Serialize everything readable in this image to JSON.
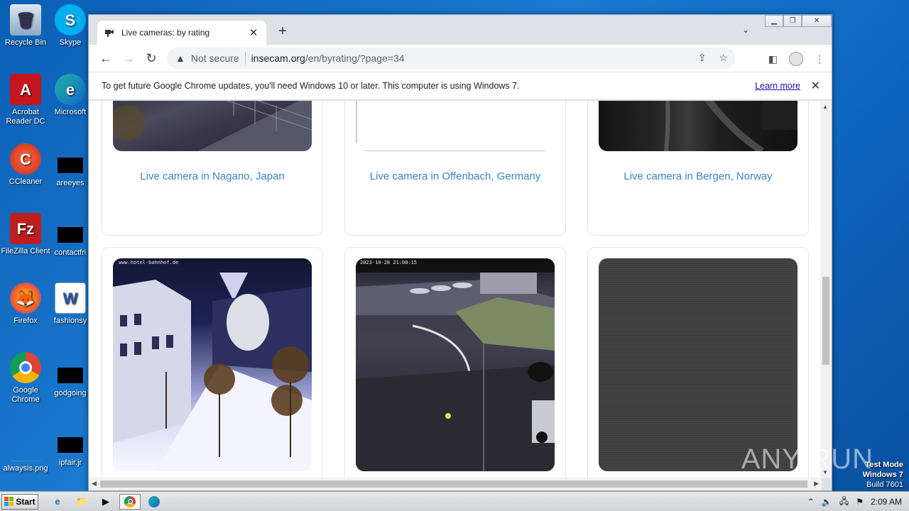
{
  "desktop": {
    "icons": [
      {
        "label": "Recycle Bin"
      },
      {
        "label": "Skype"
      },
      {
        "label": "Acrobat Reader DC"
      },
      {
        "label": "Microsoft"
      },
      {
        "label": "CCleaner"
      },
      {
        "label": "areeyes"
      },
      {
        "label": "FileZilla Client"
      },
      {
        "label": "contactfri"
      },
      {
        "label": "Firefox"
      },
      {
        "label": "fashionsy"
      },
      {
        "label": "Google Chrome"
      },
      {
        "label": "godgoing"
      },
      {
        "label": "alwaysis.png"
      },
      {
        "label": "ipfair.jr"
      }
    ]
  },
  "browser": {
    "tab_title": "Live cameras: by rating",
    "url_security": "Not secure",
    "url_host": "insecam.org",
    "url_path": "/en/byrating/?page=34",
    "infobar_text": "To get future Google Chrome updates, you'll need Windows 10 or later. This computer is using Windows 7.",
    "infobar_link": "Learn more"
  },
  "cameras": [
    {
      "caption": "Live camera in Nagano, Japan"
    },
    {
      "caption": "Live camera in Offenbach, Germany"
    },
    {
      "caption": "Live camera in Bergen, Norway"
    },
    {
      "caption": "",
      "overlay_text": "www.hotel-bahnhof.de"
    },
    {
      "caption": "",
      "overlay_text": "2023-10-28 21:08:15"
    },
    {
      "caption": ""
    }
  ],
  "taskbar": {
    "start_label": "Start",
    "clock": "2:09 AM"
  },
  "watermark": {
    "line1": "Test Mode",
    "line2": "Windows 7",
    "line3": "Build 7601",
    "brand": "ANY RUN"
  }
}
